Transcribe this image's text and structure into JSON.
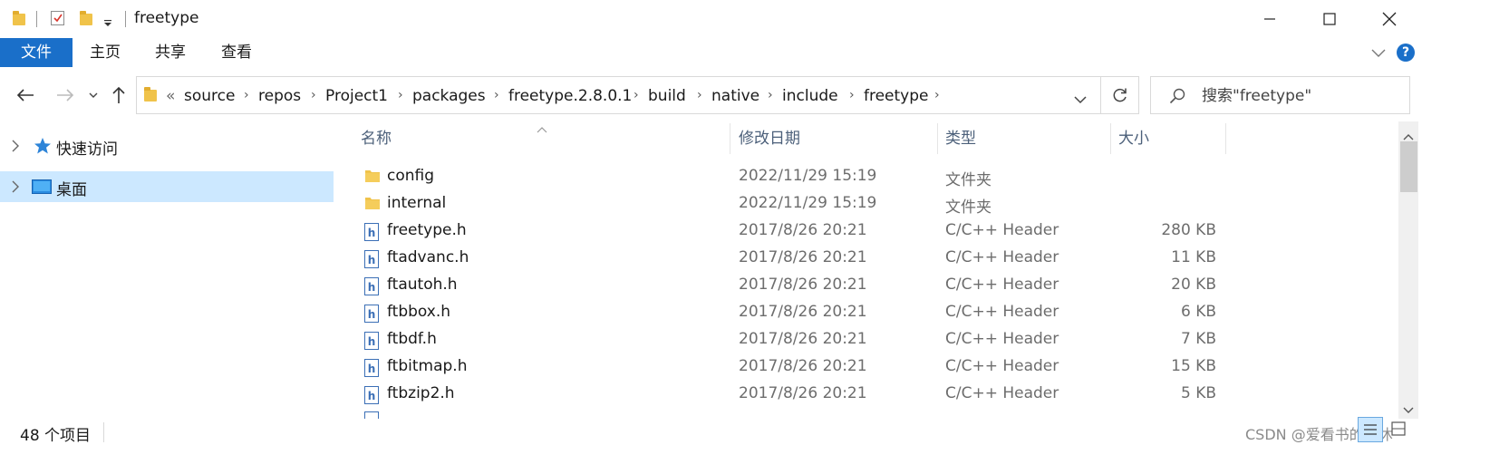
{
  "window": {
    "title": "freetype"
  },
  "ribbon": {
    "tabs": [
      "文件",
      "主页",
      "共享",
      "查看"
    ]
  },
  "address": {
    "overflow_mark": "«",
    "crumbs": [
      "source",
      "repos",
      "Project1",
      "packages",
      "freetype.2.8.0.1",
      "build",
      "native",
      "include",
      "freetype"
    ]
  },
  "search": {
    "placeholder": "搜索\"freetype\""
  },
  "nav": {
    "quick_access": "快速访问",
    "desktop": "桌面"
  },
  "columns": {
    "name": "名称",
    "date": "修改日期",
    "type": "类型",
    "size": "大小"
  },
  "files": [
    {
      "name": "config",
      "date": "2022/11/29 15:19",
      "type": "文件夹",
      "size": "",
      "kind": "folder"
    },
    {
      "name": "internal",
      "date": "2022/11/29 15:19",
      "type": "文件夹",
      "size": "",
      "kind": "folder"
    },
    {
      "name": "freetype.h",
      "date": "2017/8/26 20:21",
      "type": "C/C++ Header",
      "size": "280 KB",
      "kind": "header"
    },
    {
      "name": "ftadvanc.h",
      "date": "2017/8/26 20:21",
      "type": "C/C++ Header",
      "size": "11 KB",
      "kind": "header"
    },
    {
      "name": "ftautoh.h",
      "date": "2017/8/26 20:21",
      "type": "C/C++ Header",
      "size": "20 KB",
      "kind": "header"
    },
    {
      "name": "ftbbox.h",
      "date": "2017/8/26 20:21",
      "type": "C/C++ Header",
      "size": "6 KB",
      "kind": "header"
    },
    {
      "name": "ftbdf.h",
      "date": "2017/8/26 20:21",
      "type": "C/C++ Header",
      "size": "7 KB",
      "kind": "header"
    },
    {
      "name": "ftbitmap.h",
      "date": "2017/8/26 20:21",
      "type": "C/C++ Header",
      "size": "15 KB",
      "kind": "header"
    },
    {
      "name": "ftbzip2.h",
      "date": "2017/8/26 20:21",
      "type": "C/C++ Header",
      "size": "5 KB",
      "kind": "header"
    }
  ],
  "status": {
    "count": "48 个项目",
    "watermark": "CSDN @爱看书的小沐"
  },
  "colors": {
    "accent": "#1a6fc9",
    "selection": "#cce8ff",
    "folder": "#f0c34a",
    "header_blue": "#3b6fb6"
  },
  "icons": {
    "help": "?"
  }
}
